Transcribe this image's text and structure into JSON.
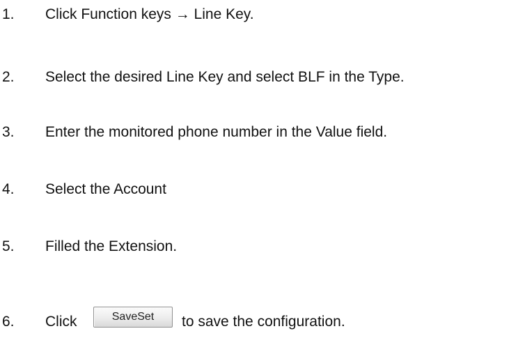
{
  "steps": [
    {
      "number": "1.",
      "text": "Click Function keys → Line Key."
    },
    {
      "number": "2.",
      "text": "Select the desired Line Key and select BLF in the Type."
    },
    {
      "number": "3.",
      "text": "Enter the monitored phone number in the Value field."
    },
    {
      "number": "4.",
      "text": "Select the Account"
    },
    {
      "number": "5.",
      "text": "Filled the Extension."
    },
    {
      "number": "6.",
      "prefix": "Click",
      "button_label": "SaveSet",
      "suffix": "to save the configuration."
    }
  ]
}
